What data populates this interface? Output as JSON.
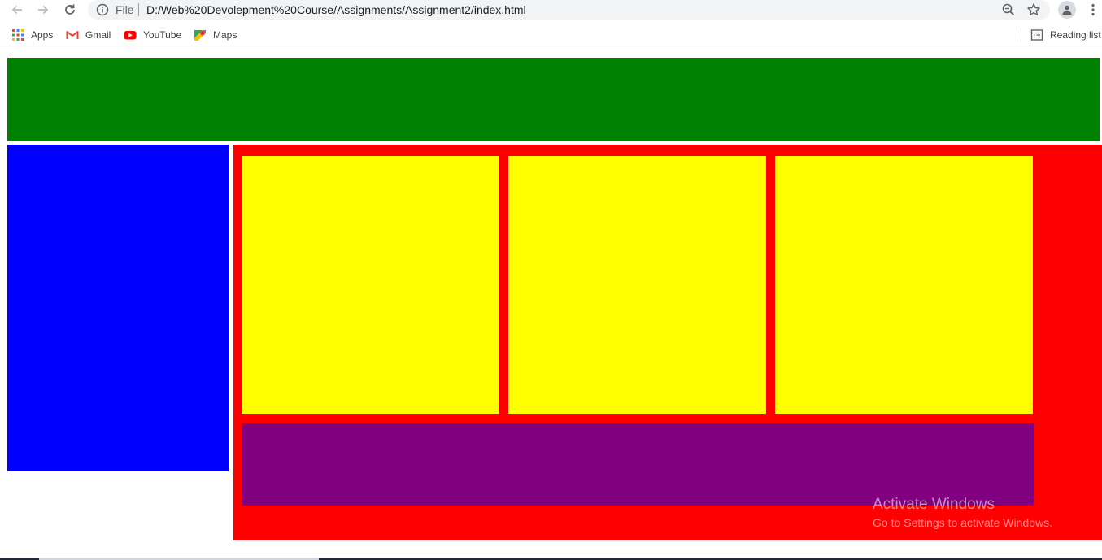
{
  "browser": {
    "file_label": "File",
    "url": "D:/Web%20Devolepment%20Course/Assignments/Assignment2/index.html",
    "icons": [
      "back-arrow-icon",
      "forward-arrow-icon",
      "reload-icon",
      "info-icon",
      "zoom-icon",
      "star-icon",
      "profile-icon",
      "menu-kebab-icon"
    ]
  },
  "bookmarks": {
    "items": [
      {
        "label": "Apps",
        "icon": "apps-grid-icon"
      },
      {
        "label": "Gmail",
        "icon": "gmail-icon"
      },
      {
        "label": "YouTube",
        "icon": "youtube-icon"
      },
      {
        "label": "Maps",
        "icon": "maps-icon"
      }
    ],
    "reading_list": {
      "label": "Reading list",
      "icon": "reading-list-icon"
    }
  },
  "page": {
    "colors": {
      "header": "#008000",
      "sidebar": "#0000ff",
      "main": "#ff0000",
      "card": "#ffff00",
      "footer": "#800080"
    }
  },
  "watermark": {
    "title": "Activate Windows",
    "subtitle": "Go to Settings to activate Windows."
  }
}
